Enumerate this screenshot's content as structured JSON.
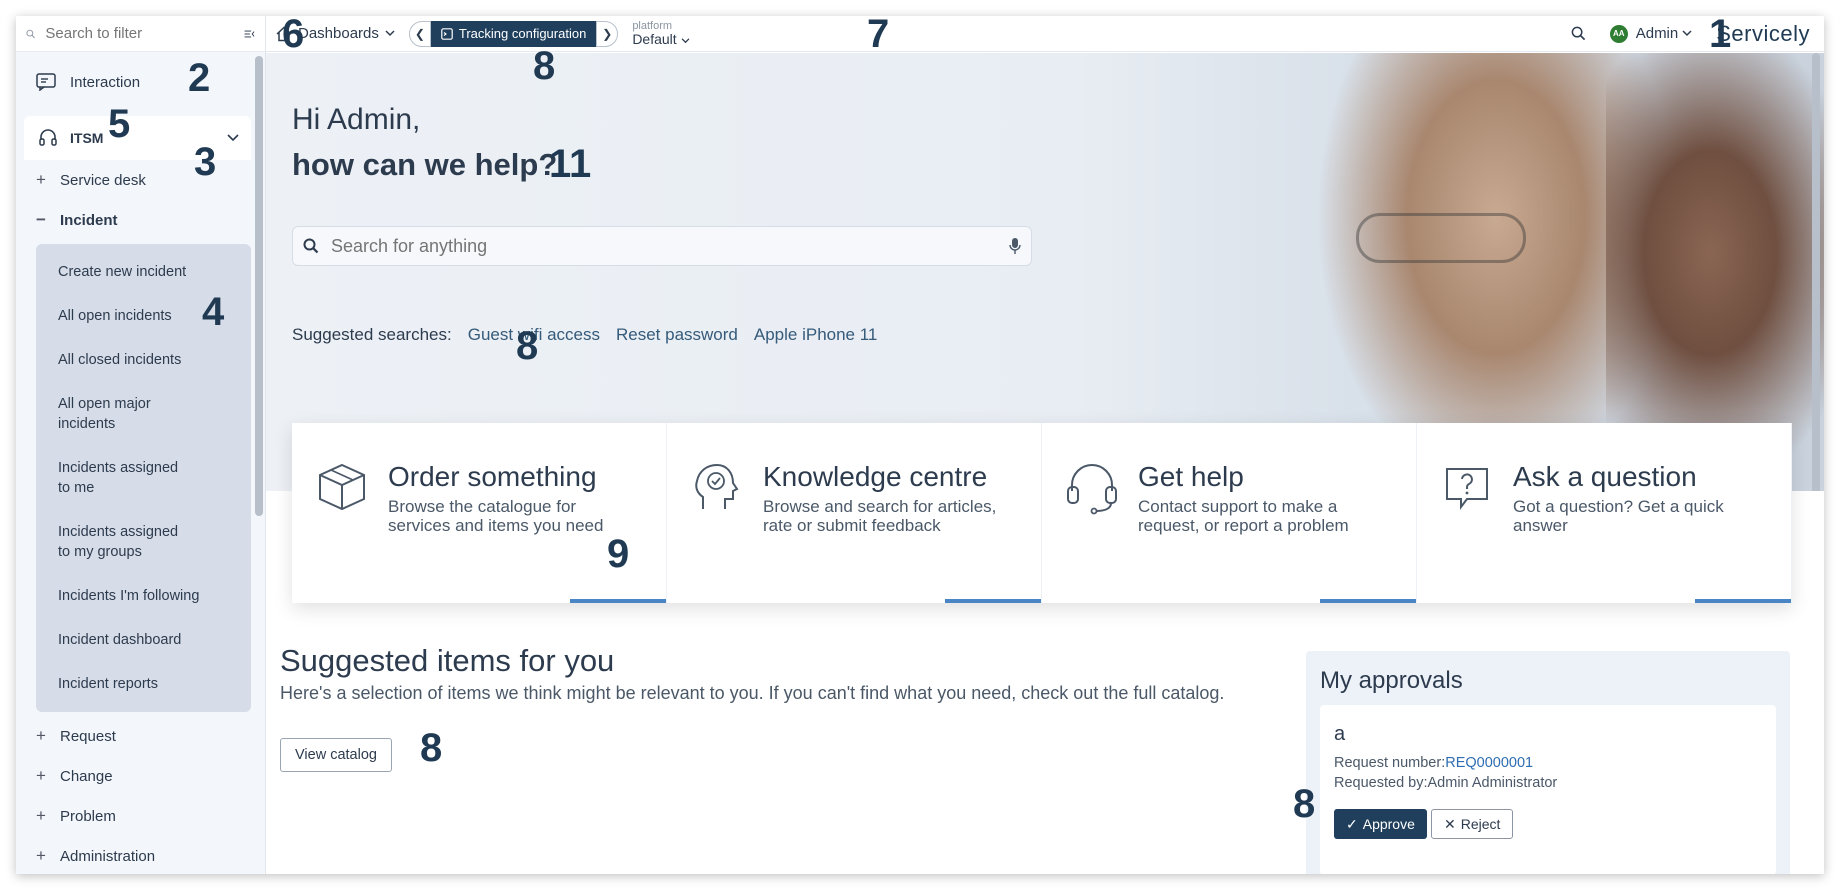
{
  "sidebar": {
    "filter_placeholder": "Search to filter",
    "interaction_label": "Interaction",
    "itsm_label": "ITSM",
    "items_before": [
      {
        "sign": "+",
        "label": "Service desk"
      },
      {
        "sign": "−",
        "label": "Incident"
      }
    ],
    "incident_sub": [
      "Create new incident",
      "All open incidents",
      "All closed incidents",
      "All open major incidents",
      "Incidents assigned to me",
      "Incidents assigned to my groups",
      "Incidents I'm following",
      "Incident dashboard",
      "Incident reports"
    ],
    "items_after": [
      {
        "sign": "+",
        "label": "Request"
      },
      {
        "sign": "+",
        "label": "Change"
      },
      {
        "sign": "+",
        "label": "Problem"
      },
      {
        "sign": "+",
        "label": "Administration"
      }
    ]
  },
  "topbar": {
    "dashboards_label": "Dashboards",
    "tab_label": "Tracking configuration",
    "platform_caption": "platform",
    "platform_value": "Default",
    "user_initials": "AA",
    "user_label": "Admin",
    "logo": "Servicely"
  },
  "hero": {
    "greeting": "Hi Admin,",
    "help": "how can we help?",
    "search_placeholder": "Search for anything",
    "suggested_caption": "Suggested searches:",
    "suggested": [
      "Guest wifi access",
      "Reset password",
      "Apple iPhone 11"
    ]
  },
  "cards": [
    {
      "icon": "box-icon",
      "title": "Order something",
      "desc": "Browse the catalogue for services and items you need"
    },
    {
      "icon": "knowledge-icon",
      "title": "Knowledge centre",
      "desc": "Browse and search for articles, rate or submit feedback"
    },
    {
      "icon": "headset-icon",
      "title": "Get help",
      "desc": "Contact support to make a request, or report a problem"
    },
    {
      "icon": "question-icon",
      "title": "Ask a question",
      "desc": "Got a question? Get a quick answer"
    }
  ],
  "suggested_items": {
    "title": "Suggested items for you",
    "desc": "Here's a selection of items we think might be relevant to you. If you can't find what you need, check out the full catalog.",
    "button": "View catalog"
  },
  "approvals": {
    "title": "My approvals",
    "item_name": "a",
    "request_number_label": "Request number:",
    "request_number": "REQ0000001",
    "requested_by": "Requested by:Admin Administrator",
    "approve": "Approve",
    "reject": "Reject"
  },
  "annotations": {
    "n1": "1",
    "n2": "2",
    "n3": "3",
    "n4": "4",
    "n5": "5",
    "n6": "6",
    "n7": "7",
    "n8": "8",
    "n9": "9",
    "n11": "11"
  },
  "colors": {
    "primary": "#1f3f5c",
    "accent_bar": "#4a86c5",
    "link": "#355a7a",
    "avatar": "#2e7d32"
  }
}
